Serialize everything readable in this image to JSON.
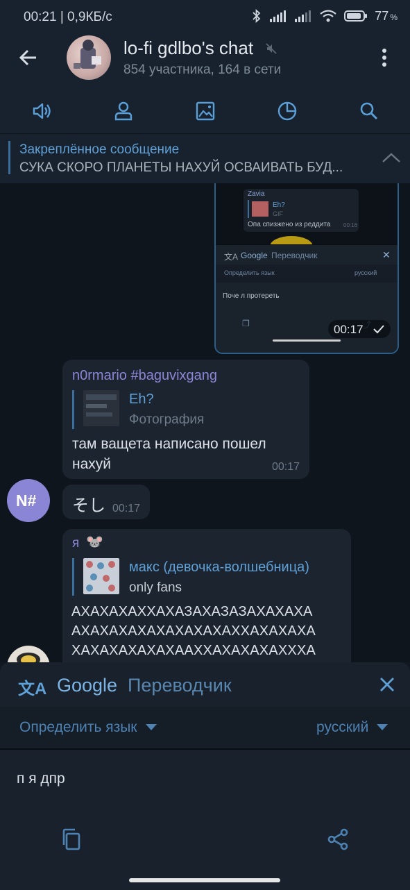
{
  "status_bar": {
    "time_and_speed": "00:21 | 0,9КБ/с",
    "battery": "77",
    "battery_unit": "%"
  },
  "header": {
    "title": "lo-fi gdlbo's chat",
    "subtitle": "854 участника, 164 в сети"
  },
  "pinned": {
    "title": "Закреплённое сообщение",
    "text": "СУКА СКОРО ПЛАНЕТЫ НАХУЙ ОСВАИВАТЬ БУД..."
  },
  "screenshot_message": {
    "inner_sender": "Zavia",
    "inner_reply_title": "Eh?",
    "inner_reply_sub": "GIF",
    "inner_text": "Опа спизжено из реддита",
    "inner_time": "00:16",
    "inner_tr_brand": "Google",
    "inner_tr_service": "Переводчик",
    "inner_tr_detect": "Определить язык",
    "inner_tr_lang": "русский",
    "inner_tr_text": "Поче л протереть",
    "time": "00:17"
  },
  "message_nomario": {
    "sender": "n0rmario #baguvixgang",
    "reply_title": "Eh?",
    "reply_sub": "Фотография",
    "text_line1": "там ващета написано пошел",
    "text_line2": "нахуй",
    "time": "00:17"
  },
  "message_so": {
    "avatar_initials": "N#",
    "text": "そし",
    "time": "00:17"
  },
  "message_me": {
    "sender": "я",
    "reply_title": "макс (девочка-волшебница)",
    "reply_sub": "only fans",
    "line1": "АХАХАХАХХАХАЗАХАЗАЗАХАХАХА",
    "line2": "АХАХАХАХАХАХАХАХАХХАХАХАХА",
    "line3": "ХАХАХАХАХАХААХХАХАХАХАХХХА"
  },
  "translator": {
    "brand": "Google",
    "service": "Переводчик",
    "detect_language": "Определить язык",
    "target_language": "русский",
    "translated_text": "п я дпр"
  },
  "colors": {
    "accent": "#5fa0d6",
    "sender_purple": "#8d86d6",
    "avatar_purple": "#8a85d4"
  }
}
